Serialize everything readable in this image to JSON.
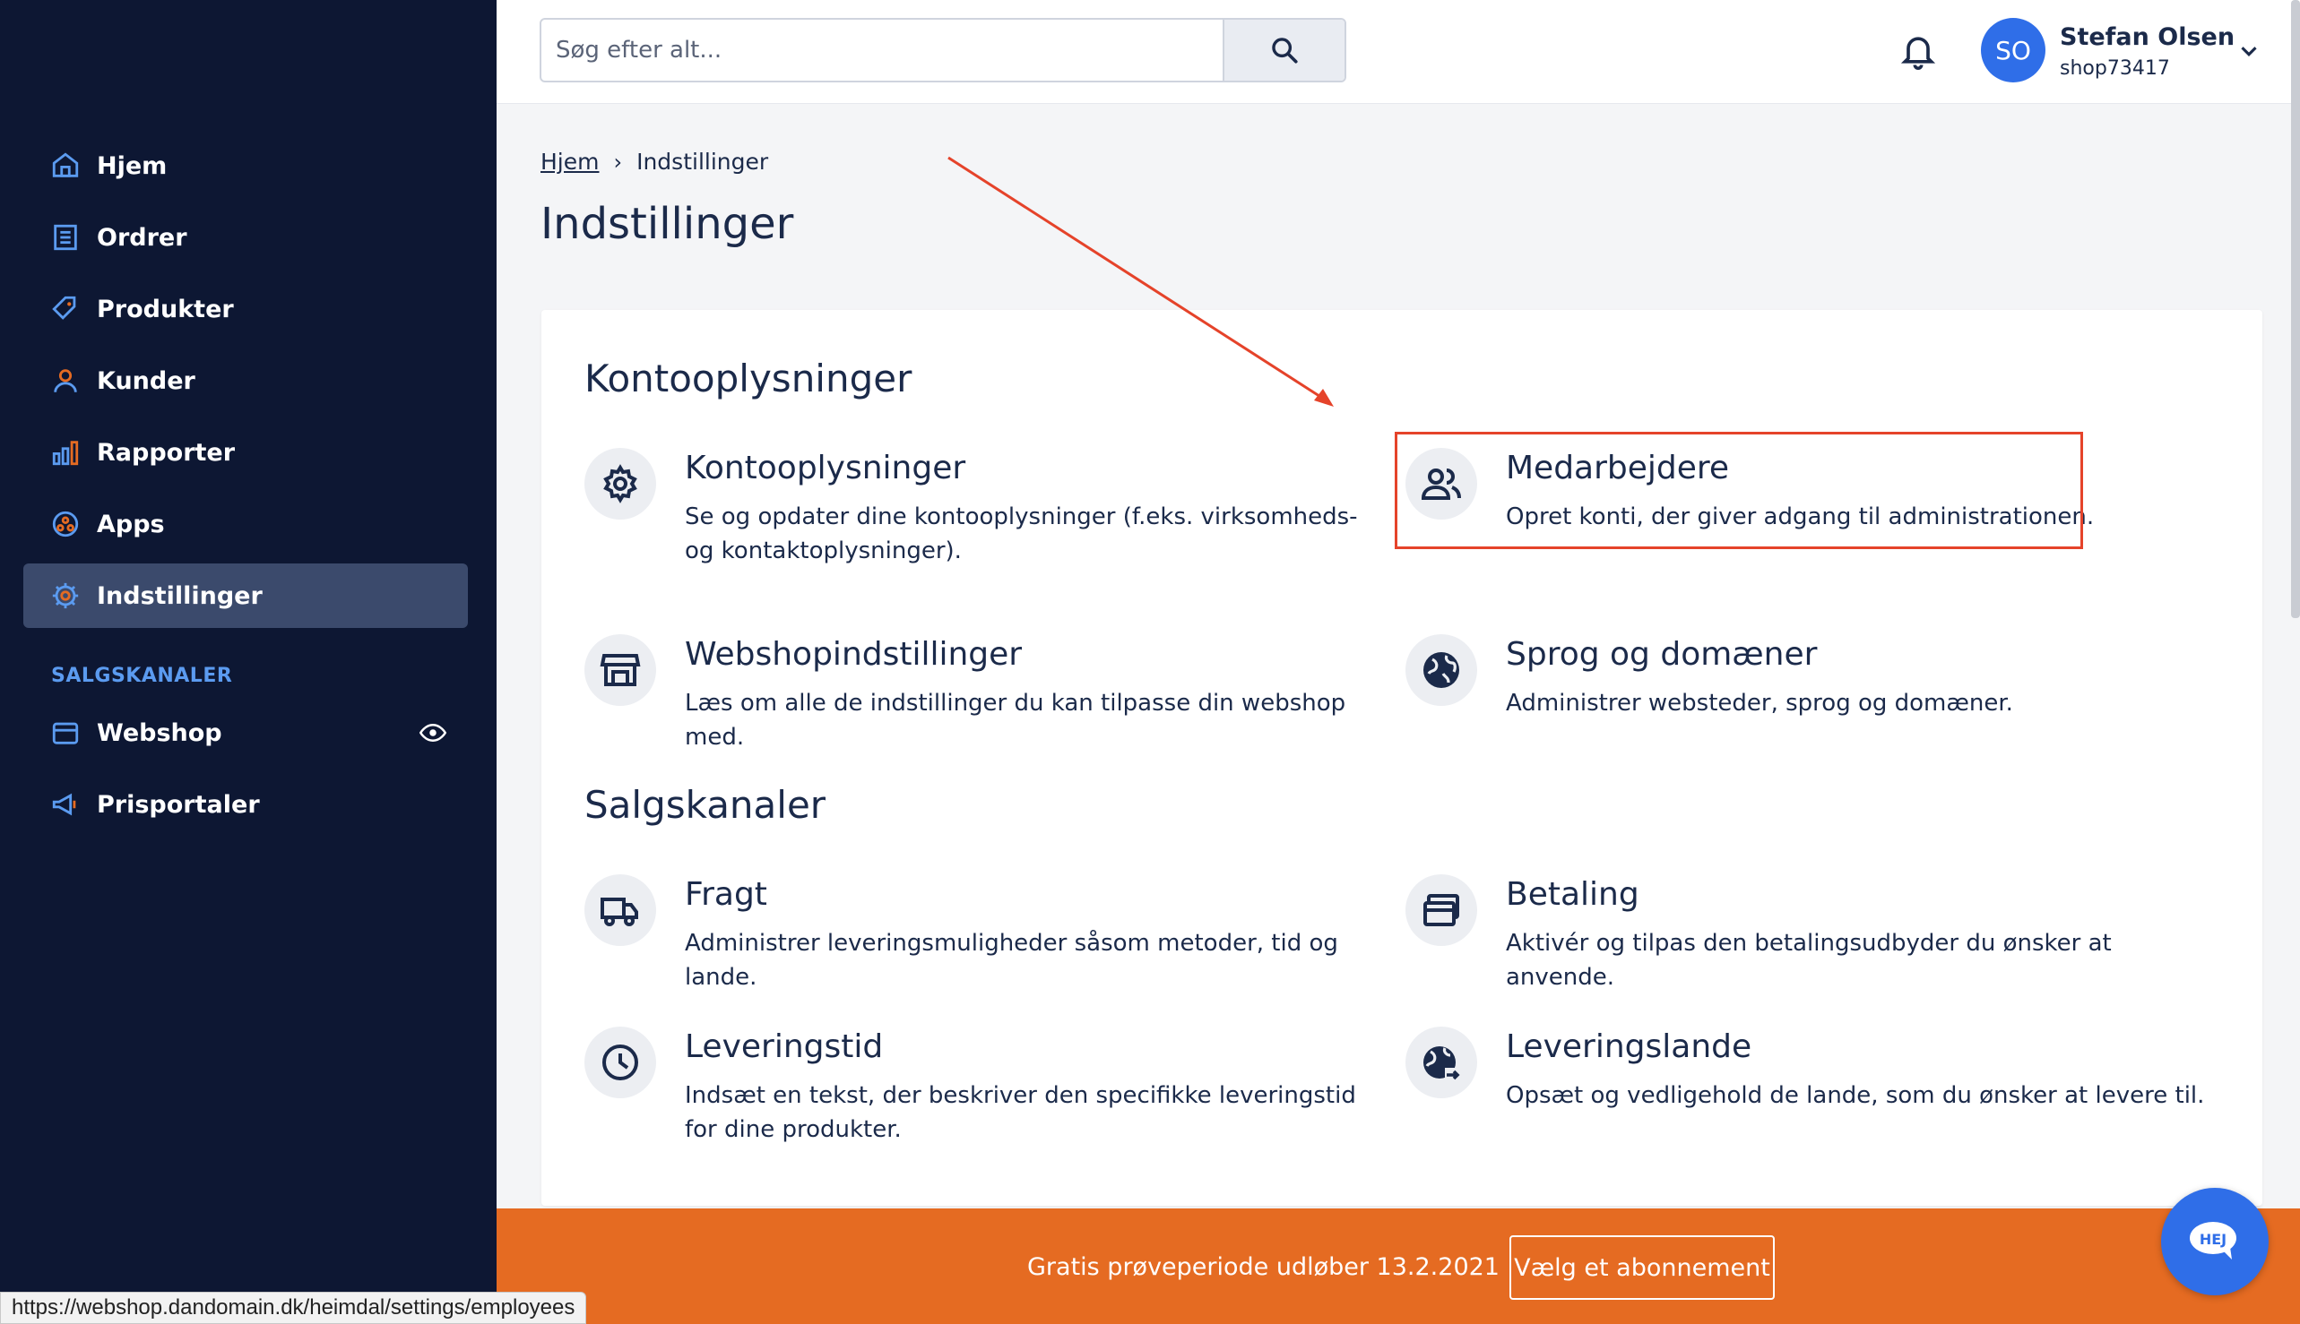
{
  "sidebar": {
    "items": [
      {
        "label": "Hjem",
        "icon": "home-icon"
      },
      {
        "label": "Ordrer",
        "icon": "orders-icon"
      },
      {
        "label": "Produkter",
        "icon": "tag-icon"
      },
      {
        "label": "Kunder",
        "icon": "user-icon"
      },
      {
        "label": "Rapporter",
        "icon": "bar-chart-icon"
      },
      {
        "label": "Apps",
        "icon": "apps-icon"
      },
      {
        "label": "Indstillinger",
        "icon": "gear-icon",
        "active": true
      }
    ],
    "section_label": "SALGSKANALER",
    "channels": [
      {
        "label": "Webshop",
        "icon": "storefront-icon"
      },
      {
        "label": "Prisportaler",
        "icon": "megaphone-icon"
      }
    ]
  },
  "topbar": {
    "search_placeholder": "Søg efter alt...",
    "user": {
      "initials": "SO",
      "name": "Stefan Olsen",
      "shop": "shop73417"
    }
  },
  "breadcrumb": {
    "home": "Hjem",
    "current": "Indstillinger"
  },
  "page_title": "Indstillinger",
  "sections": [
    {
      "title": "Kontooplysninger",
      "items": [
        {
          "title": "Kontooplysninger",
          "desc": "Se og opdater dine kontooplysninger (f.eks. virksomheds- og kontaktoplysninger).",
          "icon": "gear-icon"
        },
        {
          "title": "Medarbejdere",
          "desc": "Opret konti, der giver adgang til administrationen.",
          "icon": "users-icon"
        },
        {
          "title": "Webshopindstillinger",
          "desc": "Læs om alle de indstillinger du kan tilpasse din webshop med.",
          "icon": "store-icon"
        },
        {
          "title": "Sprog og domæner",
          "desc": "Administrer websteder, sprog og domæner.",
          "icon": "globe-icon"
        }
      ]
    },
    {
      "title": "Salgskanaler",
      "items": [
        {
          "title": "Fragt",
          "desc": "Administrer leveringsmuligheder såsom metoder, tid og lande.",
          "icon": "truck-icon"
        },
        {
          "title": "Betaling",
          "desc": "Aktivér og tilpas den betalingsudbyder du ønsker at anvende.",
          "icon": "credit-card-icon"
        },
        {
          "title": "Leveringstid",
          "desc": "Indsæt en tekst, der beskriver den specifikke leveringstid for dine produkter.",
          "icon": "clock-icon"
        },
        {
          "title": "Leveringslande",
          "desc": "Opsæt og vedligehold de lande, som du ønsker at levere til.",
          "icon": "globe-arrow-icon"
        }
      ]
    }
  ],
  "banner": {
    "text": "Gratis prøveperiode udløber 13.2.2021",
    "button": "Vælg et abonnement"
  },
  "chat": {
    "label": "HEJ"
  },
  "status_url": "https://webshop.dandomain.dk/heimdal/settings/employees",
  "colors": {
    "sidebar_bg": "#0d1733",
    "accent": "#2f6ee8",
    "banner": "#e56b22",
    "highlight": "#e5432a",
    "section_label": "#5b9bf0"
  }
}
